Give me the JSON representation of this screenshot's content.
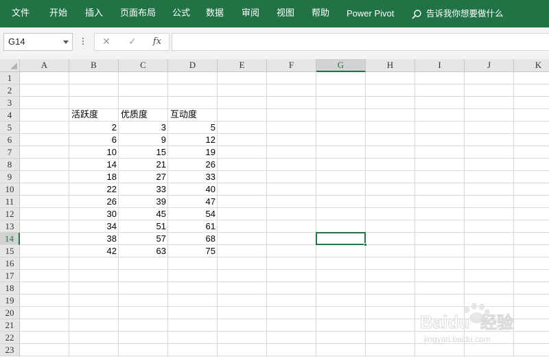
{
  "ribbon": {
    "tabs": [
      "文件",
      "开始",
      "插入",
      "页面布局",
      "公式",
      "数据",
      "审阅",
      "视图",
      "帮助",
      "Power Pivot"
    ],
    "tell_me": "告诉我你想要做什么"
  },
  "formula_bar": {
    "name_box": "G14",
    "fx_label": "fx",
    "formula_value": ""
  },
  "colors": {
    "ribbon": "#217346",
    "selection": "#217346"
  },
  "grid": {
    "columns": [
      "A",
      "B",
      "C",
      "D",
      "E",
      "F",
      "G",
      "H",
      "I",
      "J",
      "K"
    ],
    "rows": [
      "1",
      "2",
      "3",
      "4",
      "5",
      "6",
      "7",
      "8",
      "9",
      "10",
      "11",
      "12",
      "13",
      "14",
      "15",
      "16",
      "17",
      "18",
      "19",
      "20",
      "21",
      "22",
      "23"
    ],
    "selected_cell": "G14",
    "selected_column": "G",
    "selected_row": "14",
    "headers": {
      "B4": "活跃度",
      "C4": "优质度",
      "D4": "互动度"
    },
    "data": [
      [
        "2",
        "3",
        "5"
      ],
      [
        "6",
        "9",
        "12"
      ],
      [
        "10",
        "15",
        "19"
      ],
      [
        "14",
        "21",
        "26"
      ],
      [
        "18",
        "27",
        "33"
      ],
      [
        "22",
        "33",
        "40"
      ],
      [
        "26",
        "39",
        "47"
      ],
      [
        "30",
        "45",
        "54"
      ],
      [
        "34",
        "51",
        "61"
      ],
      [
        "38",
        "57",
        "68"
      ],
      [
        "42",
        "63",
        "75"
      ]
    ]
  },
  "watermark": {
    "brand": "Baidu",
    "brand_cn": "经验",
    "url": "jingyan.baidu.com"
  }
}
